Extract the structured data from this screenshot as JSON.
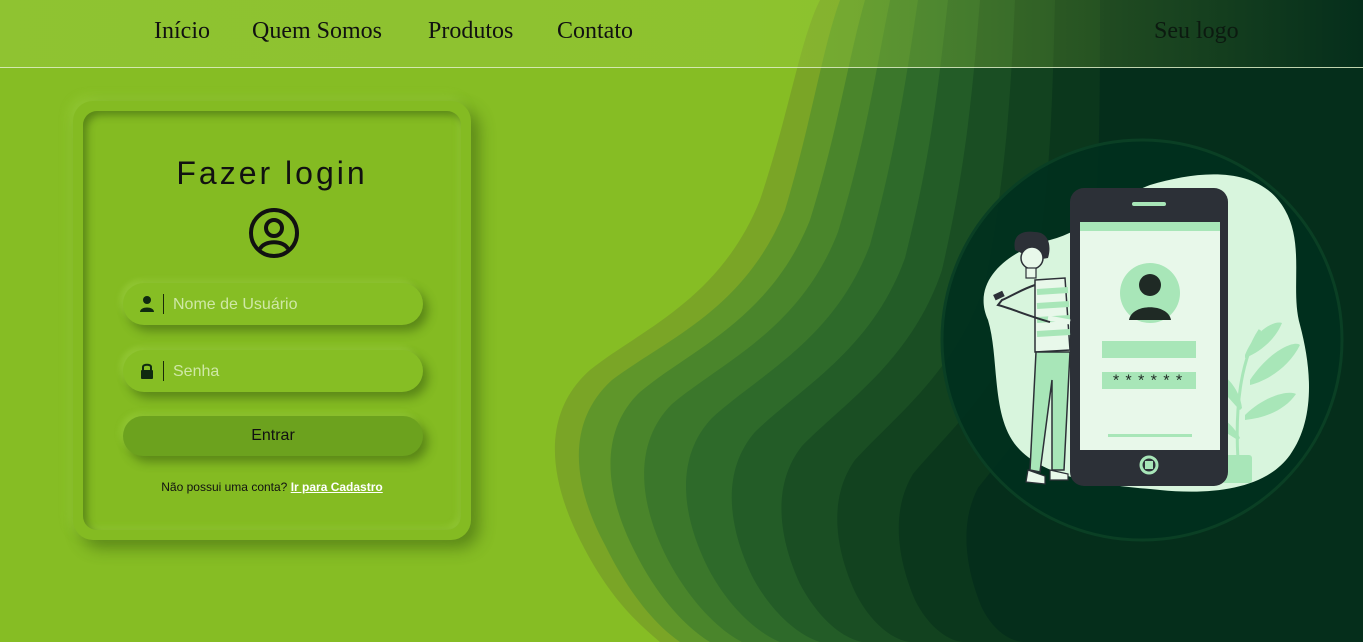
{
  "nav": {
    "links": [
      "Início",
      "Quem Somos",
      "Produtos",
      "Contato"
    ],
    "logo": "Seu logo"
  },
  "login": {
    "title": "Fazer login",
    "avatar_icon": "user-circle-icon",
    "username": {
      "icon": "user-icon",
      "placeholder": "Nome de Usuário",
      "value": ""
    },
    "password": {
      "icon": "lock-icon",
      "placeholder": "Senha",
      "value": ""
    },
    "submit_label": "Entrar",
    "signup_prompt": "Não possui uma conta?",
    "signup_link": "Ir para Cadastro"
  },
  "illustration": {
    "password_mask": "******",
    "icon": "phone-login-illustration"
  },
  "colors": {
    "lime": "#86bd24",
    "dark_green": "#002d1c",
    "mint": "#a8e6b8",
    "phone_body": "#2c3037"
  }
}
